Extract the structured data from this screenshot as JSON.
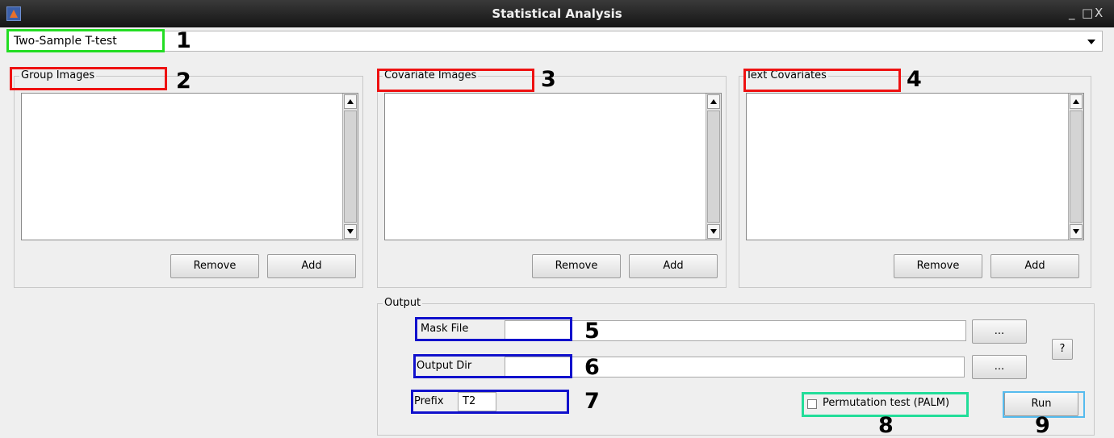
{
  "window": {
    "title": "Statistical Analysis",
    "controls": [
      "_",
      "□",
      "X"
    ]
  },
  "analysis_type": {
    "selected": "Two-Sample T-test"
  },
  "panels": {
    "group_images": {
      "legend": "Group Images",
      "remove_label": "Remove",
      "add_label": "Add"
    },
    "covariate_images": {
      "legend": "Covariate Images",
      "remove_label": "Remove",
      "add_label": "Add"
    },
    "text_covariates": {
      "legend": "Text Covariates",
      "remove_label": "Remove",
      "add_label": "Add"
    }
  },
  "output": {
    "legend": "Output",
    "mask_file_label": "Mask File",
    "mask_file_value": "",
    "output_dir_label": "Output Dir",
    "output_dir_value": "",
    "prefix_label": "Prefix",
    "prefix_value": "T2",
    "browse_label": "...",
    "help_label": "?",
    "permutation_label": "Permutation test (PALM)",
    "permutation_checked": false,
    "run_label": "Run"
  },
  "annotations": [
    "1",
    "2",
    "3",
    "4",
    "5",
    "6",
    "7",
    "8",
    "9"
  ],
  "highlight_colors": {
    "green": "#22dd22",
    "red": "#ee1111",
    "blue": "#1111cc",
    "teal": "#22dd99",
    "cyan": "#55bbee"
  }
}
